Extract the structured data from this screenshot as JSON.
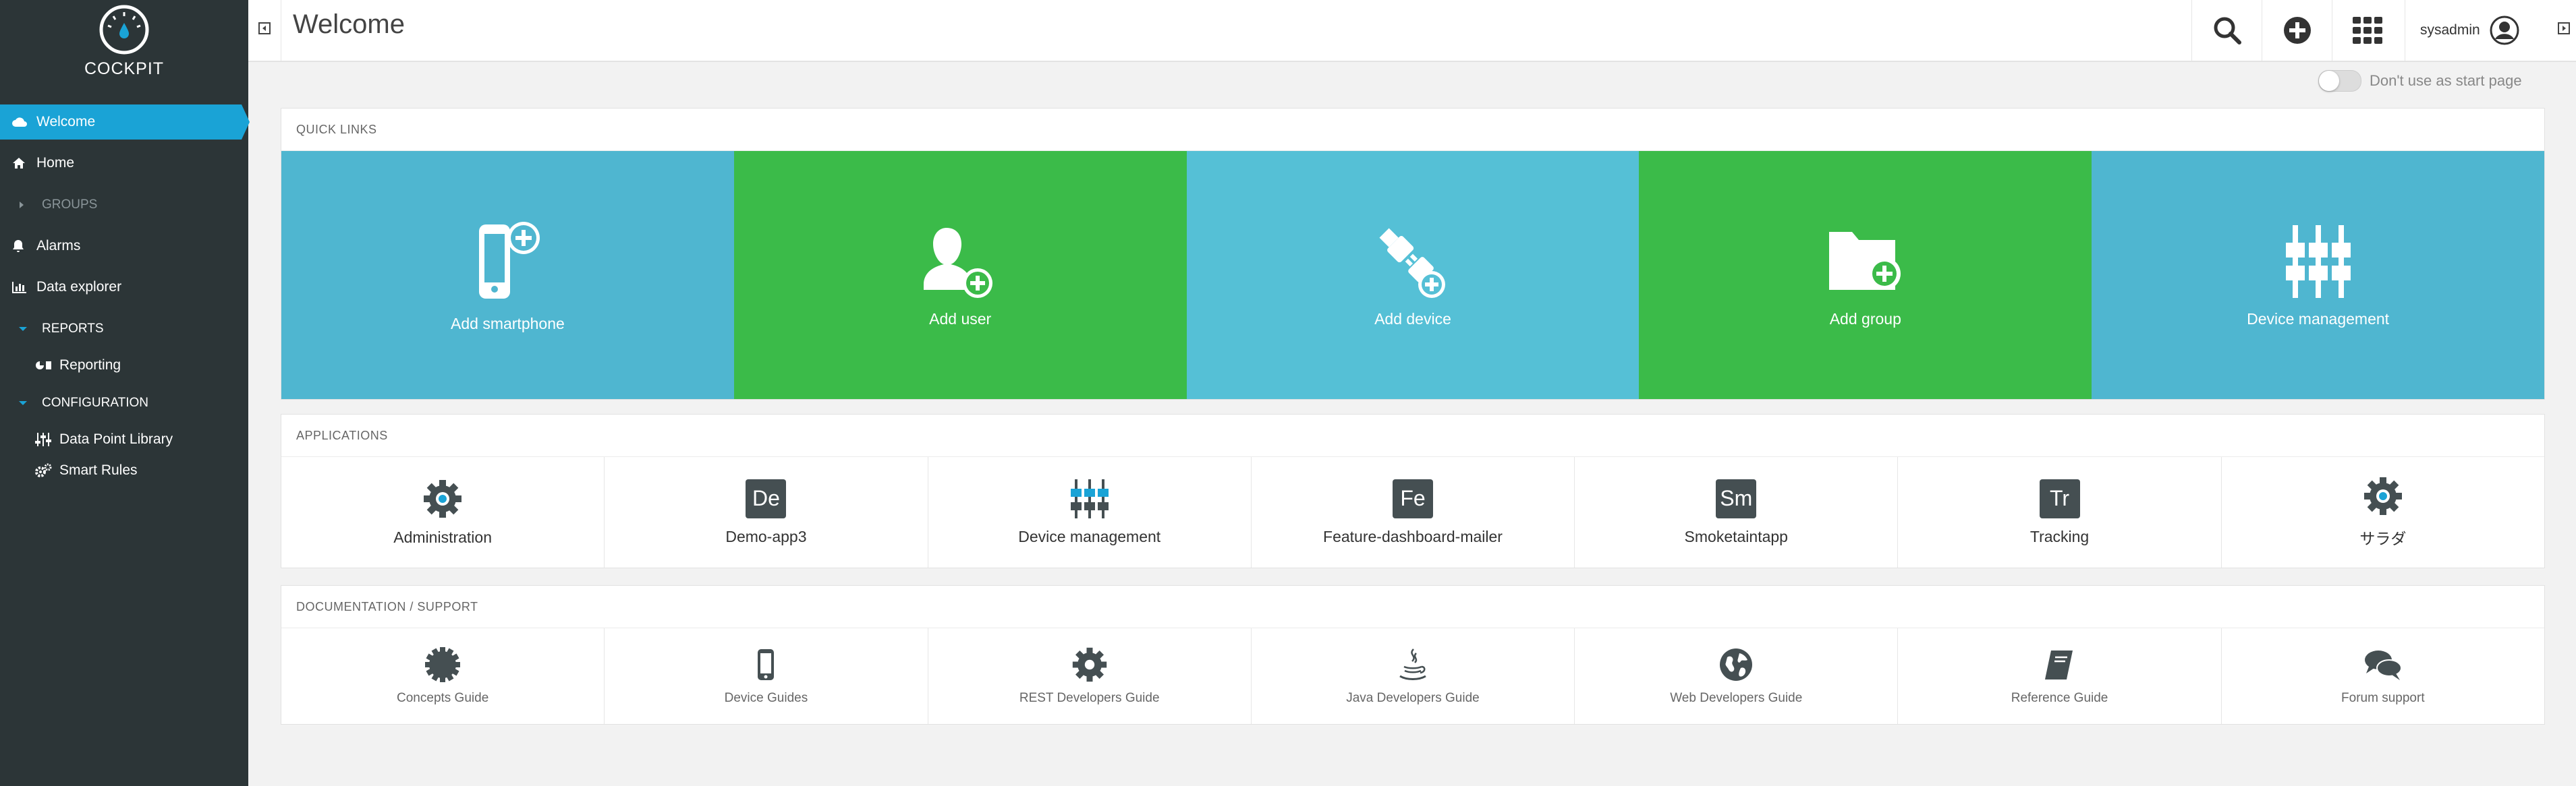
{
  "app": {
    "name": "COCKPIT"
  },
  "sidebar": {
    "items": [
      {
        "label": "Welcome",
        "icon": "cloud-icon",
        "active": true
      },
      {
        "label": "Home",
        "icon": "home-icon"
      },
      {
        "label": "GROUPS",
        "icon": "chevron-right-icon"
      },
      {
        "label": "Alarms",
        "icon": "bell-icon"
      },
      {
        "label": "Data explorer",
        "icon": "bar-chart-icon"
      },
      {
        "label": "REPORTS",
        "icon": "chevron-down-icon"
      },
      {
        "label": "Reporting",
        "icon": "report-icon"
      },
      {
        "label": "CONFIGURATION",
        "icon": "chevron-down-icon"
      },
      {
        "label": "Data Point Library",
        "icon": "sliders-icon"
      },
      {
        "label": "Smart Rules",
        "icon": "cogs-icon"
      }
    ]
  },
  "header": {
    "title": "Welcome",
    "username": "sysadmin"
  },
  "start_page_toggle": {
    "label": "Don't use as start page",
    "on": false
  },
  "quick_links": {
    "heading": "QUICK LINKS",
    "items": [
      {
        "label": "Add smartphone",
        "icon": "smartphone-add-icon",
        "color": "#4fb6d0"
      },
      {
        "label": "Add user",
        "icon": "user-add-icon",
        "color": "#3bbb49"
      },
      {
        "label": "Add device",
        "icon": "plug-add-icon",
        "color": "#55c0d6"
      },
      {
        "label": "Add group",
        "icon": "folder-add-icon",
        "color": "#3bbb49"
      },
      {
        "label": "Device management",
        "icon": "sliders-icon",
        "color": "#4fb6d0"
      }
    ]
  },
  "applications": {
    "heading": "APPLICATIONS",
    "items": [
      {
        "label": "Administration",
        "icon": "gear-icon"
      },
      {
        "label": "Demo-app3",
        "badge": "De"
      },
      {
        "label": "Device management",
        "icon": "sliders-icon"
      },
      {
        "label": "Feature-dashboard-mailer",
        "badge": "Fe"
      },
      {
        "label": "Smoketaintapp",
        "badge": "Sm"
      },
      {
        "label": "Tracking",
        "badge": "Tr"
      },
      {
        "label": "サラダ",
        "icon": "gear-icon"
      }
    ]
  },
  "documentation": {
    "heading": "DOCUMENTATION / SUPPORT",
    "items": [
      {
        "label": "Concepts Guide",
        "icon": "badge-icon"
      },
      {
        "label": "Device Guides",
        "icon": "phone-icon"
      },
      {
        "label": "REST Developers Guide",
        "icon": "gear-icon"
      },
      {
        "label": "Java Developers Guide",
        "icon": "java-icon"
      },
      {
        "label": "Web Developers Guide",
        "icon": "globe-icon"
      },
      {
        "label": "Reference Guide",
        "icon": "book-icon"
      },
      {
        "label": "Forum support",
        "icon": "chat-icon"
      }
    ]
  }
}
